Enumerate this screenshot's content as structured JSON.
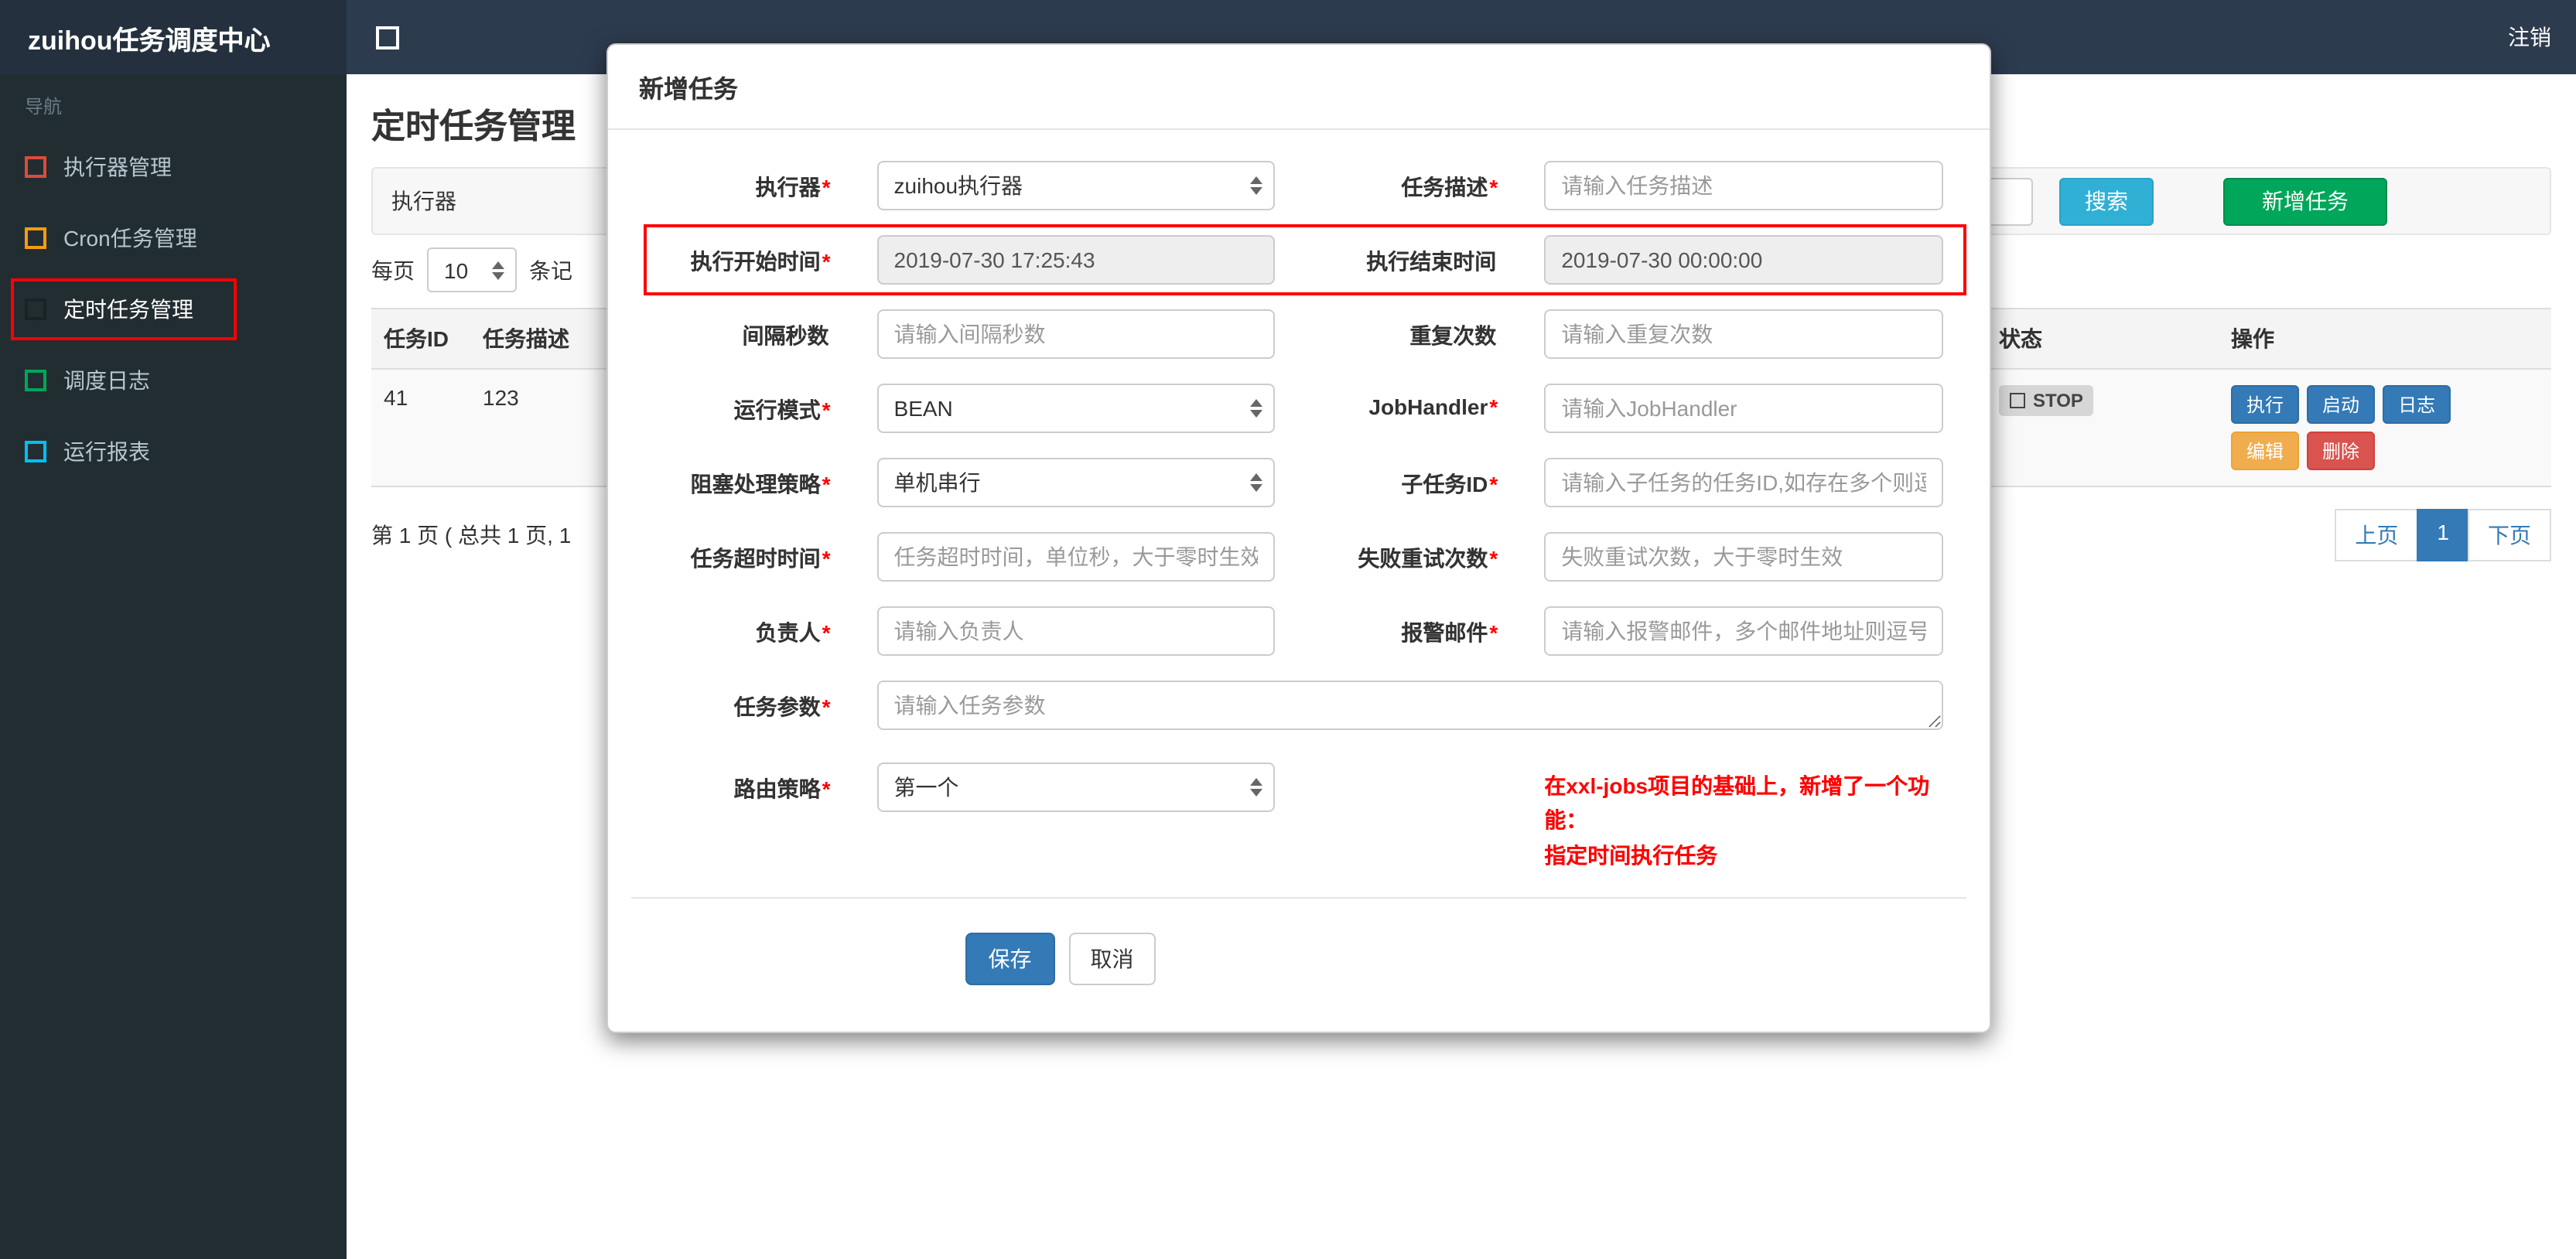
{
  "app": {
    "brand": "zuihou任务调度中心",
    "logout": "注销"
  },
  "colors": {
    "primary": "#337ab7",
    "success": "#00a65a",
    "info": "#31b0d5",
    "warning": "#f0ad4e",
    "danger": "#d9534f",
    "annotation": "#ff0000",
    "header": "#2c3b4e",
    "sidebar": "#222d32"
  },
  "sidebar": {
    "section": "导航",
    "items": [
      {
        "label": "执行器管理",
        "color": "#dd4b39"
      },
      {
        "label": "Cron任务管理",
        "color": "#f39c12"
      },
      {
        "label": "定时任务管理",
        "color": "#1a2226",
        "active": true
      },
      {
        "label": "调度日志",
        "color": "#00a65a"
      },
      {
        "label": "运行报表",
        "color": "#00c0ef"
      }
    ]
  },
  "page": {
    "title": "定时任务管理",
    "toolbar": {
      "executor_label": "执行器",
      "search": "搜索",
      "add": "新增任务"
    },
    "perpage": {
      "prefix": "每页",
      "value": "10",
      "suffix": "条记"
    },
    "table": {
      "headers": [
        "任务ID",
        "任务描述",
        "状态",
        "操作"
      ],
      "row": {
        "id": "41",
        "desc": "123",
        "status": "STOP",
        "ops": [
          "执行",
          "启动",
          "日志",
          "编辑",
          "删除"
        ]
      }
    },
    "pagination": {
      "summary": "第 1 页 ( 总共 1 页, 1",
      "prev": "上页",
      "current": "1",
      "next": "下页"
    }
  },
  "modal": {
    "title": "新增任务",
    "rows": [
      {
        "left": {
          "label": "执行器",
          "star": "*",
          "value": "zuihou执行器"
        },
        "right": {
          "label": "任务描述",
          "star": "*",
          "placeholder": "请输入任务描述"
        }
      },
      {
        "left": {
          "label": "执行开始时间",
          "star": "*",
          "value": "2019-07-30 17:25:43"
        },
        "right": {
          "label": "执行结束时间",
          "star": "",
          "value": "2019-07-30 00:00:00"
        }
      },
      {
        "left": {
          "label": "间隔秒数",
          "star": "",
          "placeholder": "请输入间隔秒数"
        },
        "right": {
          "label": "重复次数",
          "star": "",
          "placeholder": "请输入重复次数"
        }
      },
      {
        "left": {
          "label": "运行模式",
          "star": "*",
          "value": "BEAN"
        },
        "right": {
          "label": "JobHandler",
          "star": "*",
          "placeholder": "请输入JobHandler"
        }
      },
      {
        "left": {
          "label": "阻塞处理策略",
          "star": "*",
          "value": "单机串行"
        },
        "right": {
          "label": "子任务ID",
          "star": "*",
          "placeholder": "请输入子任务的任务ID,如存在多个则逗"
        }
      },
      {
        "left": {
          "label": "任务超时时间",
          "star": "*",
          "placeholder": "任务超时时间，单位秒，大于零时生效"
        },
        "right": {
          "label": "失败重试次数",
          "star": "*",
          "placeholder": "失败重试次数，大于零时生效"
        }
      },
      {
        "left": {
          "label": "负责人",
          "star": "*",
          "placeholder": "请输入负责人"
        },
        "right": {
          "label": "报警邮件",
          "star": "*",
          "placeholder": "请输入报警邮件，多个邮件地址则逗号分"
        }
      }
    ],
    "params": {
      "label": "任务参数",
      "star": "*",
      "placeholder": "请输入任务参数"
    },
    "route": {
      "label": "路由策略",
      "star": "*",
      "value": "第一个",
      "note1": "在xxl-jobs项目的基础上，新增了一个功能：",
      "note2": "指定时间执行任务"
    },
    "save": "保存",
    "cancel": "取消"
  }
}
